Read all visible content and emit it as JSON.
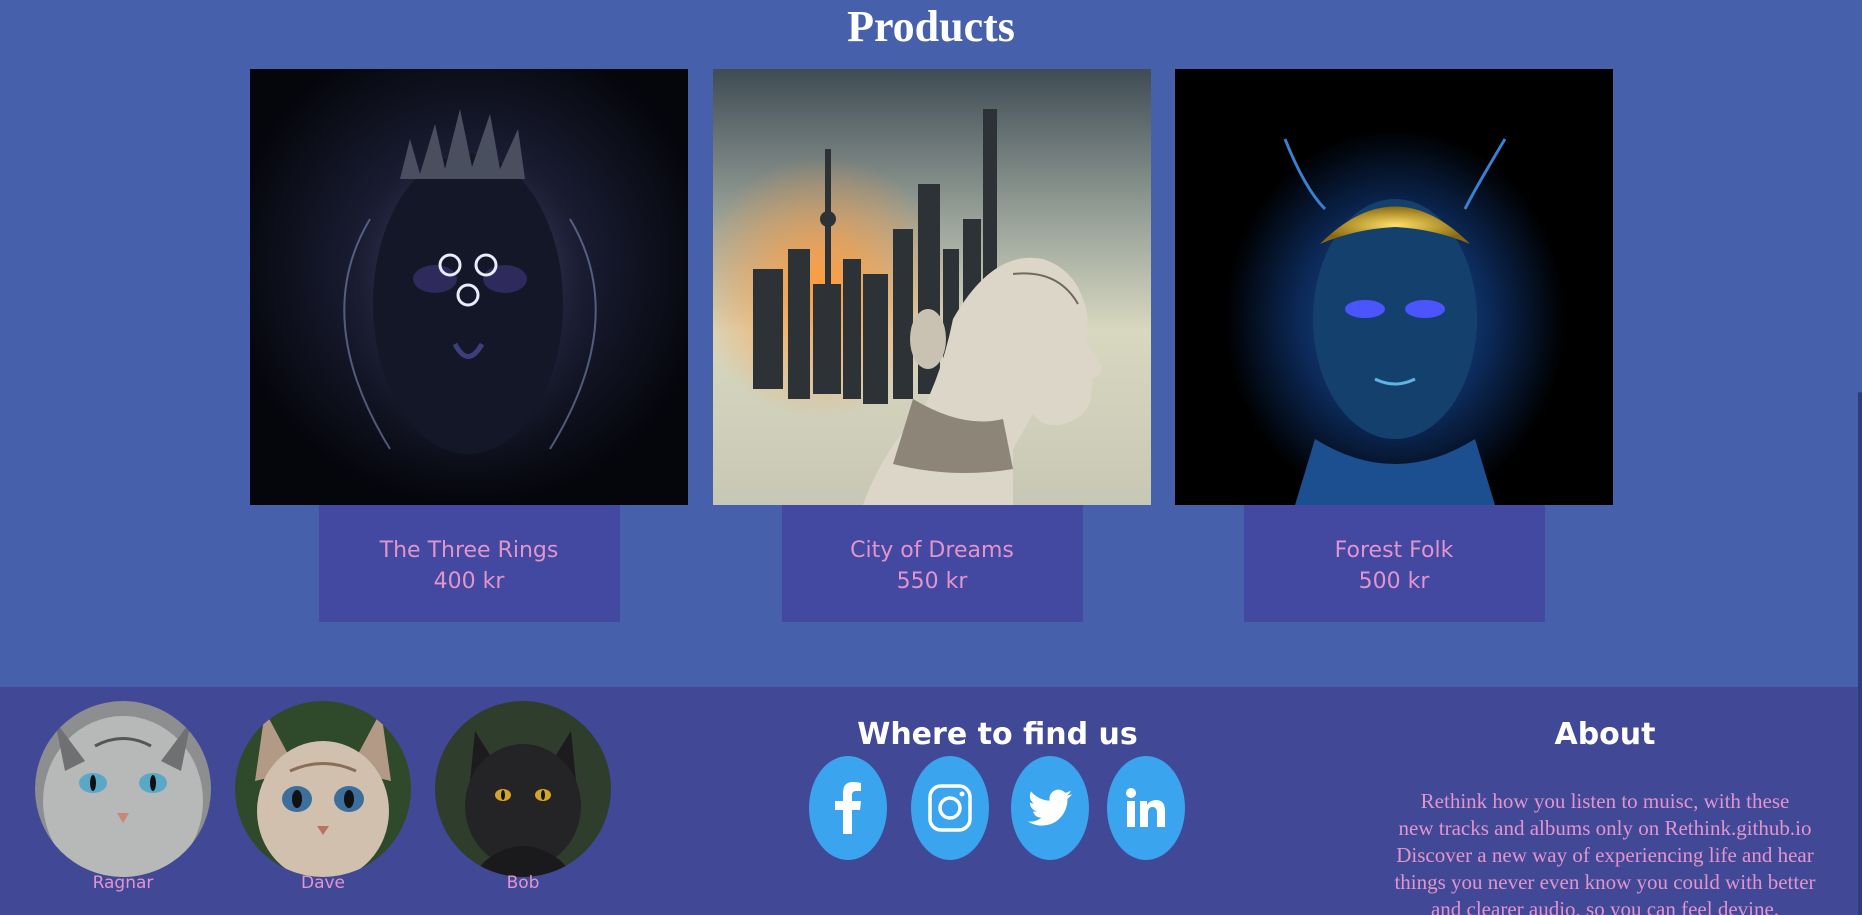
{
  "products_section": {
    "title": "Products",
    "items": [
      {
        "name": "The Three Rings",
        "price": "400 kr",
        "image": "dark-mask-face-artwork"
      },
      {
        "name": "City of Dreams",
        "price": "550 kr",
        "image": "woman-city-double-exposure"
      },
      {
        "name": "Forest Folk",
        "price": "500 kr",
        "image": "glowing-blue-face-artwork"
      }
    ]
  },
  "footer": {
    "team": [
      {
        "name": "Ragnar",
        "image": "grey-cat-photo"
      },
      {
        "name": "Dave",
        "image": "tabby-cat-photo"
      },
      {
        "name": "Bob",
        "image": "black-cat-photo"
      }
    ],
    "find_us": {
      "title": "Where to find us",
      "links": [
        {
          "icon": "facebook-icon"
        },
        {
          "icon": "instagram-icon"
        },
        {
          "icon": "twitter-icon"
        },
        {
          "icon": "linkedin-icon"
        }
      ]
    },
    "about": {
      "title": "About",
      "lines": [
        "Rethink how you listen to muisc, with these",
        "new tracks and albums only on Rethink.github.io",
        "Discover a new way of experiencing life and hear",
        "things you never even know you could with better",
        "and clearer audio, so you can feel devine."
      ]
    }
  },
  "colors": {
    "page_background": "#4660ac",
    "footer_background": "#414997",
    "card_background": "#4348a0",
    "accent_pink": "#e294cc",
    "social_blue": "#3ba4ee"
  }
}
